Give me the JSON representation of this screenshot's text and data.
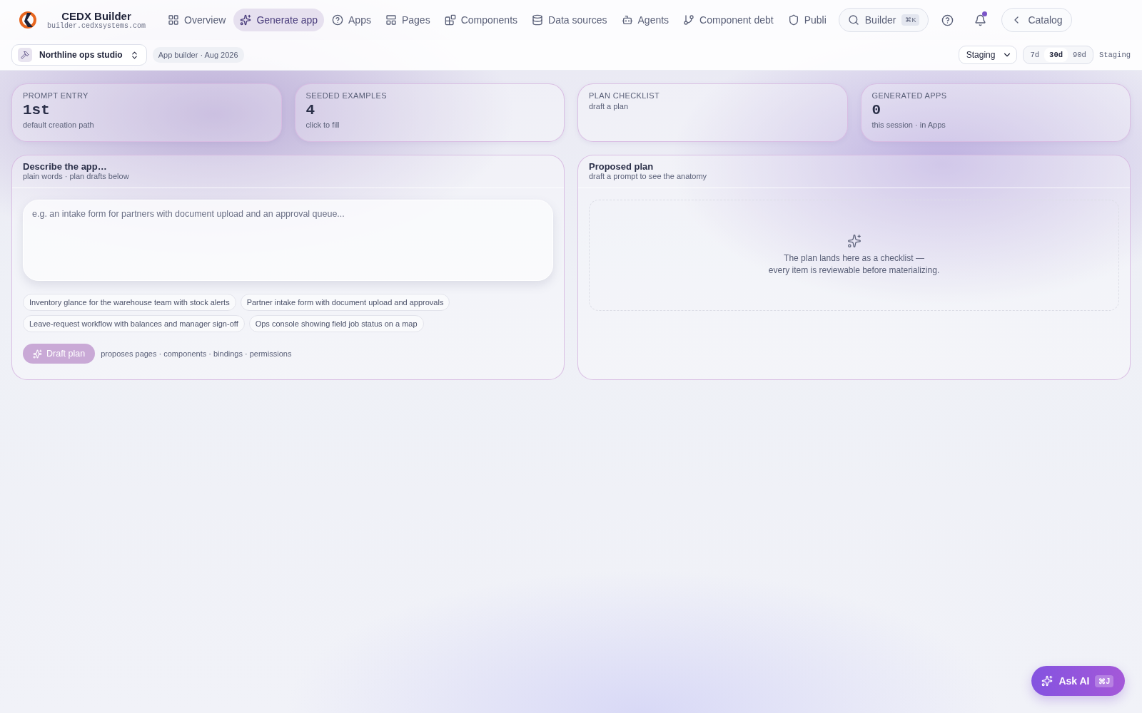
{
  "brand": {
    "name": "CEDX Builder",
    "domain": "builder.cedxsystems.com"
  },
  "nav": [
    {
      "label": "Overview",
      "selected": false
    },
    {
      "label": "Generate app",
      "selected": true
    },
    {
      "label": "Apps",
      "selected": false
    },
    {
      "label": "Pages",
      "selected": false
    },
    {
      "label": "Components",
      "selected": false
    },
    {
      "label": "Data sources",
      "selected": false
    },
    {
      "label": "Agents",
      "selected": false
    },
    {
      "label": "Component debt",
      "selected": false
    },
    {
      "label": "Publi",
      "selected": false
    }
  ],
  "search": {
    "label": "Builder",
    "shortcut": "⌘K"
  },
  "notifications": {
    "unread": true
  },
  "back_link": "Catalog",
  "workspace": {
    "name": "Northline ops studio",
    "badge": "App builder · Aug 2026"
  },
  "environment": {
    "value": "Staging"
  },
  "periods": [
    {
      "label": "7d",
      "selected": false
    },
    {
      "label": "30d",
      "selected": true
    },
    {
      "label": "90d",
      "selected": false
    }
  ],
  "env_label": "Staging",
  "stats": [
    {
      "label": "PROMPT ENTRY",
      "value": "1st",
      "note": "default creation path"
    },
    {
      "label": "SEEDED EXAMPLES",
      "value": "4",
      "note": "click to fill"
    },
    {
      "label": "PLAN CHECKLIST",
      "note": "draft a plan"
    },
    {
      "label": "GENERATED APPS",
      "value": "0",
      "note": "this session · in Apps"
    }
  ],
  "describe": {
    "title": "Describe the app…",
    "subtitle": "plain words · plan drafts below",
    "placeholder": "e.g. an intake form for partners with document upload and an approval queue...",
    "examples": [
      "Inventory glance for the warehouse team with stock alerts",
      "Partner intake form with document upload and approvals",
      "Leave-request workflow with balances and manager sign-off",
      "Ops console showing field job status on a map"
    ],
    "button": {
      "label": "Draft plan",
      "disabled": true
    },
    "hint": "proposes pages · components · bindings · permissions"
  },
  "plan": {
    "title": "Proposed plan",
    "subtitle": "draft a prompt to see the anatomy",
    "empty_lines": [
      "The plan lands here as a checklist —",
      "every item is reviewable before materializing."
    ]
  },
  "assistant": {
    "label": "Ask AI",
    "shortcut": "⌘J"
  }
}
